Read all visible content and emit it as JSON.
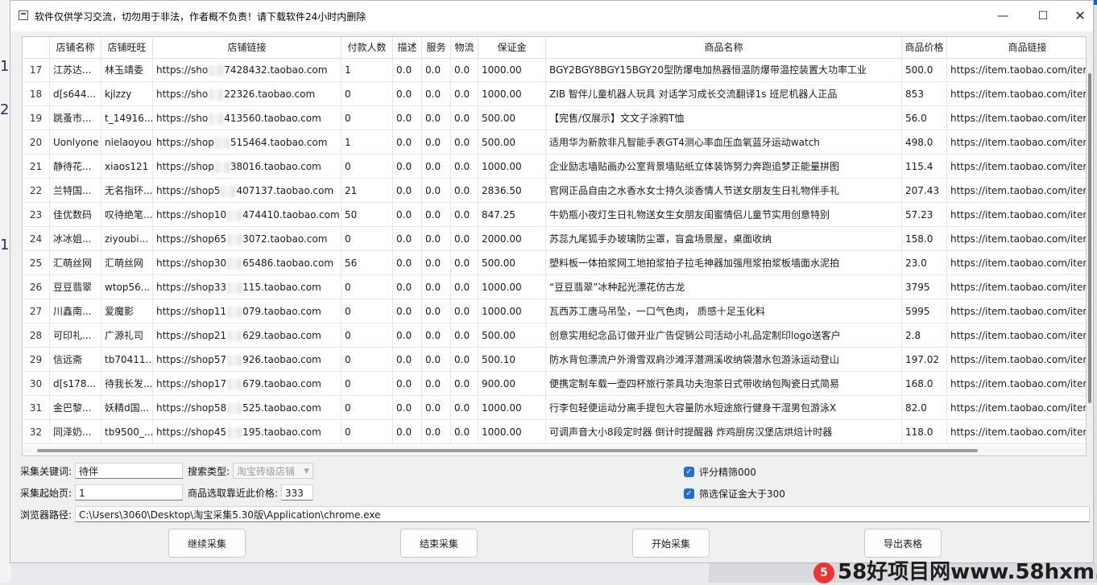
{
  "window": {
    "title": "软件仅供学习交流，切勿用于非法，作者概不负责！请下载软件24小时内删除",
    "min_glyph": "—",
    "max_glyph": "☐",
    "close_glyph": "✕"
  },
  "background": {
    "numbers": [
      "1.",
      "2.",
      "1."
    ]
  },
  "table": {
    "columns": [
      "",
      "店铺名称",
      "店铺旺旺",
      "店铺链接",
      "付款人数",
      "描述",
      "服务",
      "物流",
      "保证金",
      "商品名称",
      "商品价格",
      "商品链接"
    ],
    "rows": [
      {
        "idx": "17",
        "shop": "江苏达...",
        "ww": "林玉靖委",
        "url_a": "https://sho",
        "url_b": "7428432.taobao.com",
        "pay": "1",
        "d": "0.0",
        "s": "0.0",
        "l": "0.0",
        "deposit": "1000.00",
        "product": "BGY2BGY8BGY15BGY20型防爆电加热器恒温防爆带温控装置大功率工业",
        "price": "500.0",
        "link": "https://item.taobao.com/item"
      },
      {
        "idx": "18",
        "shop": "d[s644...",
        "ww": "kjlzzy",
        "url_a": "https://sho",
        "url_b": "22326.taobao.com",
        "pay": "0",
        "d": "0.0",
        "s": "0.0",
        "l": "0.0",
        "deposit": "1000.00",
        "product": "ZIB 智伴儿童机器人玩具 对话学习成长交流翻译1s 班尼机器人正品",
        "price": "853",
        "link": "https://item.taobao.com/item"
      },
      {
        "idx": "19",
        "shop": "跳蚤市...",
        "ww": "t_14916...",
        "url_a": "https://sho",
        "url_b": "413560.taobao.com",
        "pay": "0",
        "d": "0.0",
        "s": "0.0",
        "l": "0.0",
        "deposit": "500.00",
        "product": "【完售/仅展示】文文子涂鸦T恤",
        "price": "56.0",
        "link": "https://item.taobao.com/item"
      },
      {
        "idx": "20",
        "shop": "Uonlyone",
        "ww": "nielaoyou",
        "url_a": "https://shop",
        "url_b": "515464.taobao.com",
        "pay": "1",
        "d": "0.0",
        "s": "0.0",
        "l": "0.0",
        "deposit": "500.00",
        "product": "适用华为新款非凡智能手表GT4测心率血压血氧蓝牙运动watch",
        "price": "498.0",
        "link": "https://item.taobao.com/item"
      },
      {
        "idx": "21",
        "shop": "静待花...",
        "ww": "xiaos121",
        "url_a": "https://shop",
        "url_b": "38016.taobao.com",
        "pay": "0",
        "d": "0.0",
        "s": "0.0",
        "l": "0.0",
        "deposit": "1000.00",
        "product": "企业励志墙贴画办公室背景墙贴纸立体装饰努力奔跑追梦正能量拼图",
        "price": "115.4",
        "link": "https://item.taobao.com/item"
      },
      {
        "idx": "22",
        "shop": "兰特国...",
        "ww": "无名指环...",
        "url_a": "https://shop5",
        "url_b": "407137.taobao.com",
        "pay": "21",
        "d": "0.0",
        "s": "0.0",
        "l": "0.0",
        "deposit": "2836.50",
        "product": "官网正品自由之水香水女士持久淡香情人节送女朋友生日礼物伴手礼",
        "price": "207.43",
        "link": "https://item.taobao.com/item"
      },
      {
        "idx": "23",
        "shop": "佳优数码",
        "ww": "叹待绝笔...",
        "url_a": "https://shop10",
        "url_b": "474410.taobao.com",
        "pay": "50",
        "d": "0.0",
        "s": "0.0",
        "l": "0.0",
        "deposit": "847.25",
        "product": "牛奶瓶小夜灯生日礼物送女生女朋友闺蜜情侣儿童节实用创意特别",
        "price": "57.23",
        "link": "https://item.taobao.com/item"
      },
      {
        "idx": "24",
        "shop": "冰冰姐...",
        "ww": "ziyoubi...",
        "url_a": "https://shop65",
        "url_b": "3072.taobao.com",
        "pay": "0",
        "d": "0.0",
        "s": "0.0",
        "l": "0.0",
        "deposit": "2000.00",
        "product": "苏蕊九尾狐手办玻璃防尘罩，盲盒场景屋，桌面收纳",
        "price": "158.0",
        "link": "https://item.taobao.com/item"
      },
      {
        "idx": "25",
        "shop": "汇萌丝网",
        "ww": "汇萌丝网",
        "url_a": "https://shop30",
        "url_b": "65486.taobao.com",
        "pay": "56",
        "d": "0.0",
        "s": "0.0",
        "l": "0.0",
        "deposit": "500.00",
        "product": "塑料板一体拍浆网工地拍浆拍子拉毛神器加强甩浆拍浆板墙面水泥拍",
        "price": "23.0",
        "link": "https://item.taobao.com/item"
      },
      {
        "idx": "26",
        "shop": "豆豆翡翠",
        "ww": "wtop56...",
        "url_a": "https://shop33",
        "url_b": "115.taobao.com",
        "pay": "0",
        "d": "0.0",
        "s": "0.0",
        "l": "0.0",
        "deposit": "1000.00",
        "product": "“豆豆翡翠”冰种起光漂花仿古龙",
        "price": "3795",
        "link": "https://item.taobao.com/item"
      },
      {
        "idx": "27",
        "shop": "川鑫南...",
        "ww": "爱魔影",
        "url_a": "https://shop11",
        "url_b": "079.taobao.com",
        "pay": "0",
        "d": "0.0",
        "s": "0.0",
        "l": "0.0",
        "deposit": "1000.00",
        "product": "瓦西苏工唐马吊坠，一口气色肉， 质感十足玉化料",
        "price": "5995",
        "link": "https://item.taobao.com/item"
      },
      {
        "idx": "28",
        "shop": "可印礼...",
        "ww": "广源礼司",
        "url_a": "https://shop21",
        "url_b": "629.taobao.com",
        "pay": "0",
        "d": "0.0",
        "s": "0.0",
        "l": "0.0",
        "deposit": "500.00",
        "product": "创意实用纪念品订做开业广告促销公司活动小礼品定制印logo送客户",
        "price": "2.8",
        "link": "https://item.taobao.com/item"
      },
      {
        "idx": "29",
        "shop": "信远斋",
        "ww": "tb70411...",
        "url_a": "https://shop57",
        "url_b": "926.taobao.com",
        "pay": "0",
        "d": "0.0",
        "s": "0.0",
        "l": "0.0",
        "deposit": "500.10",
        "product": "防水背包漂流户外滑雪双肩沙滩浮潜溯溪收纳袋潜水包游泳运动登山",
        "price": "197.02",
        "link": "https://item.taobao.com/item"
      },
      {
        "idx": "30",
        "shop": "d[s178...",
        "ww": "待我长发...",
        "url_a": "https://shop17",
        "url_b": "679.taobao.com",
        "pay": "0",
        "d": "0.0",
        "s": "0.0",
        "l": "0.0",
        "deposit": "900.00",
        "product": "便携定制车载一壶四杯旅行茶具功夫泡茶日式带收纳包陶瓷日式简易",
        "price": "168.0",
        "link": "https://item.taobao.com/item"
      },
      {
        "idx": "31",
        "shop": "金巴黎...",
        "ww": "妖精d国...",
        "url_a": "https://shop58",
        "url_b": "525.taobao.com",
        "pay": "0",
        "d": "0.0",
        "s": "0.0",
        "l": "0.0",
        "deposit": "1000.00",
        "product": "行李包轻便运动分离手提包大容量防水短途旅行健身干湿男包游泳X",
        "price": "82.0",
        "link": "https://item.taobao.com/item"
      },
      {
        "idx": "32",
        "shop": "同泽奶...",
        "ww": "tb9500_...",
        "url_a": "https://shop45",
        "url_b": "195.taobao.com",
        "pay": "0",
        "d": "0.0",
        "s": "0.0",
        "l": "0.0",
        "deposit": "1000.00",
        "product": "可调声音大小8段定时器 倒计时提醒器 炸鸡厨房汉堡店烘焙计时器",
        "price": "118.0",
        "link": "https://item.taobao.com/item"
      }
    ]
  },
  "form": {
    "keyword_label": "采集关键词:",
    "keyword_value": "待伴",
    "search_type_label": "搜索类型:",
    "search_type_value": "淘宝砖级店铺",
    "start_page_label": "采集起始页:",
    "start_page_value": "1",
    "near_price_label": "商品选取靠近此价格:",
    "near_price_value": "333",
    "check_rating_label": "评分精筛000",
    "check_deposit_label": "筛选保证金大于300",
    "browser_path_label": "浏览器路径:",
    "browser_path_value": "C:\\Users\\3060\\Desktop\\淘宝采集5.30版\\Application\\chrome.exe"
  },
  "buttons": {
    "continue": "继续采集",
    "stop": "结束采集",
    "start": "开始采集",
    "export": "导出表格"
  },
  "watermark": {
    "logo_text": "5",
    "text": "58好项目网www.58hxm.com"
  }
}
